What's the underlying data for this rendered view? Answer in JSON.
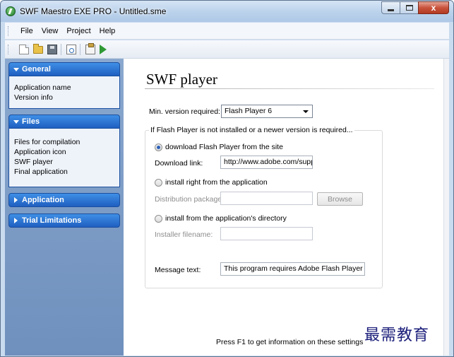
{
  "window": {
    "title": "SWF Maestro EXE PRO - Untitled.sme",
    "close_glyph": "x"
  },
  "menubar": {
    "items": [
      "File",
      "View",
      "Project",
      "Help"
    ]
  },
  "toolbar": {
    "icons": [
      "new-file-icon",
      "open-folder-icon",
      "save-icon",
      "preview-icon",
      "build-icon",
      "run-icon"
    ]
  },
  "sidebar": {
    "general": {
      "header": "General",
      "items": [
        "Application name",
        "Version info"
      ]
    },
    "files": {
      "header": "Files",
      "items": [
        "Files for compilation",
        "Application icon",
        "SWF player",
        "Final application"
      ]
    },
    "application": {
      "header": "Application"
    },
    "trial": {
      "header": "Trial Limitations"
    }
  },
  "main": {
    "title": "SWF player",
    "min_version_label": "Min. version required:",
    "min_version_value": "Flash Player 6",
    "group_legend": "If Flash Player is not installed or a newer version is required...",
    "option_download": "download Flash Player from the site",
    "download_link_label": "Download link:",
    "download_link_value": "http://www.adobe.com/supp",
    "option_install_app": "install right from the application",
    "distribution_label": "Distribution package:",
    "distribution_value": "",
    "browse_label": "Browse",
    "option_install_dir": "install from the application's directory",
    "installer_label": "Installer filename:",
    "installer_value": "",
    "message_label": "Message text:",
    "message_value": "This program requires Adobe Flash Player Activ",
    "hint": "Press F1 to get information on these settings"
  },
  "watermark": "最需教育",
  "colors": {
    "panel_header": "#1f5fc0",
    "sidebar_bg": "#7f9ec8",
    "radio_dot": "#2b60b8"
  }
}
